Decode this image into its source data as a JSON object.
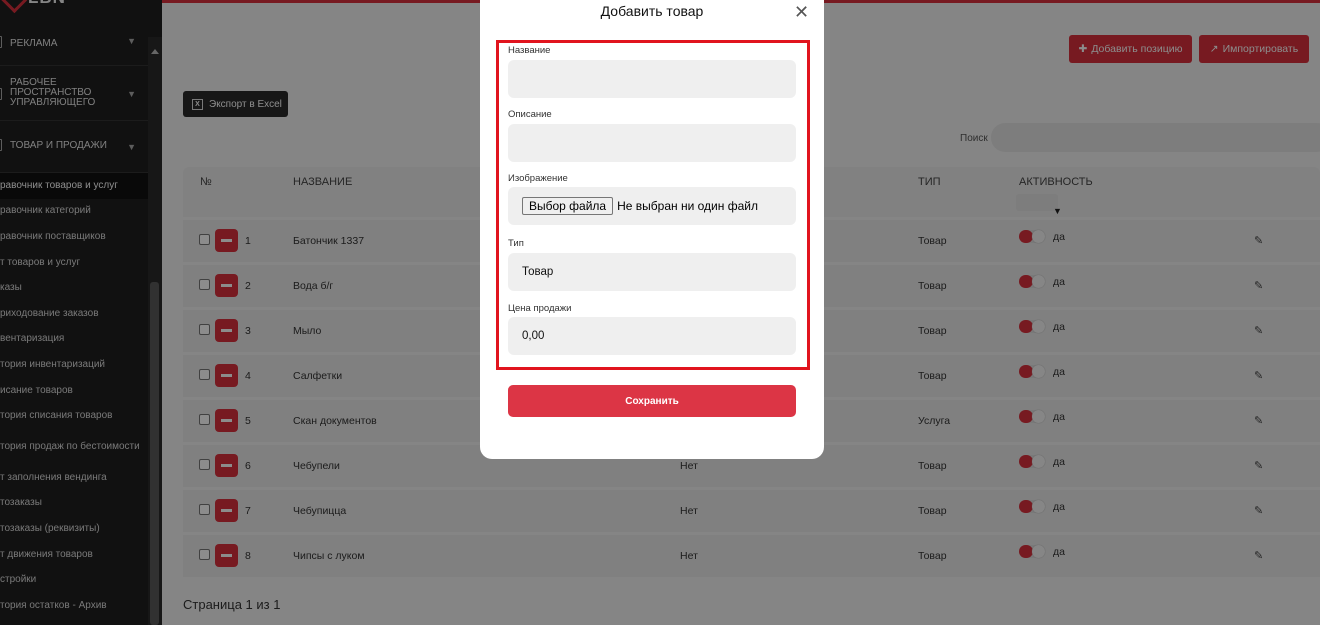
{
  "brand": {
    "logo_text": "LBN"
  },
  "sidebar": {
    "sections": [
      {
        "label": "РЕКЛАМА"
      },
      {
        "label": "РАБОЧЕЕ ПРОСТРАНСТВО УПРАВЛЯЮЩЕГО"
      },
      {
        "label": "ТОВАР И ПРОДАЖИ"
      }
    ],
    "items": [
      {
        "label": "равочник товаров и услуг"
      },
      {
        "label": "равочник категорий"
      },
      {
        "label": "равочник поставщиков"
      },
      {
        "label": "т товаров и услуг"
      },
      {
        "label": "казы"
      },
      {
        "label": "риходование заказов"
      },
      {
        "label": "вентаризация"
      },
      {
        "label": "тория инвентаризаций"
      },
      {
        "label": "исание товаров"
      },
      {
        "label": "тория списания товаров"
      },
      {
        "label": "тория продаж по бестоимости"
      },
      {
        "label": "т заполнения вендинга"
      },
      {
        "label": "тозаказы"
      },
      {
        "label": "тозаказы (реквизиты)"
      },
      {
        "label": "т движения товаров"
      },
      {
        "label": "стройки"
      },
      {
        "label": "тория остатков - Архив"
      }
    ]
  },
  "toolbar": {
    "add_position": "Добавить позицию",
    "import": "Импортировать",
    "export_excel": "Экспорт в Excel",
    "search_label": "Поиск"
  },
  "table": {
    "headers": {
      "num": "№",
      "name": "НАЗВАНИЕ",
      "type": "ТИП",
      "active": "АКТИВНОСТЬ"
    },
    "rows": [
      {
        "num": "1",
        "name": "Батончик 1337",
        "desc": "",
        "type": "Товар",
        "active": "да"
      },
      {
        "num": "2",
        "name": "Вода б/г",
        "desc": "",
        "type": "Товар",
        "active": "да"
      },
      {
        "num": "3",
        "name": "Мыло",
        "desc": "",
        "type": "Товар",
        "active": "да"
      },
      {
        "num": "4",
        "name": "Салфетки",
        "desc": "",
        "type": "Товар",
        "active": "да"
      },
      {
        "num": "5",
        "name": "Скан документов",
        "desc": "",
        "type": "Услуга",
        "active": "да"
      },
      {
        "num": "6",
        "name": "Чебупели",
        "desc": "Нет",
        "type": "Товар",
        "active": "да"
      },
      {
        "num": "7",
        "name": "Чебупицца",
        "desc": "Нет",
        "type": "Товар",
        "active": "да"
      },
      {
        "num": "8",
        "name": "Чипсы с луком",
        "desc": "Нет",
        "type": "Товар",
        "active": "да"
      }
    ],
    "pager": "Страница 1 из 1"
  },
  "modal": {
    "title": "Добавить товар",
    "fields": {
      "name_label": "Название",
      "name_value": "",
      "desc_label": "Описание",
      "desc_value": "",
      "image_label": "Изображение",
      "file_button": "Выбор файла",
      "file_status": "Не выбран ни один файл",
      "type_label": "Тип",
      "type_value": "Товар",
      "price_label": "Цена продажи",
      "price_value": "0,00"
    },
    "save": "Сохранить"
  },
  "colors": {
    "accent": "#d9313d",
    "highlight": "#e1141e",
    "sidebar": "#1f1f1f"
  },
  "icons": {
    "close": "close-icon",
    "edit": "pencil-icon",
    "excel": "excel-icon",
    "plus": "plus-icon",
    "external": "external-link-icon"
  }
}
